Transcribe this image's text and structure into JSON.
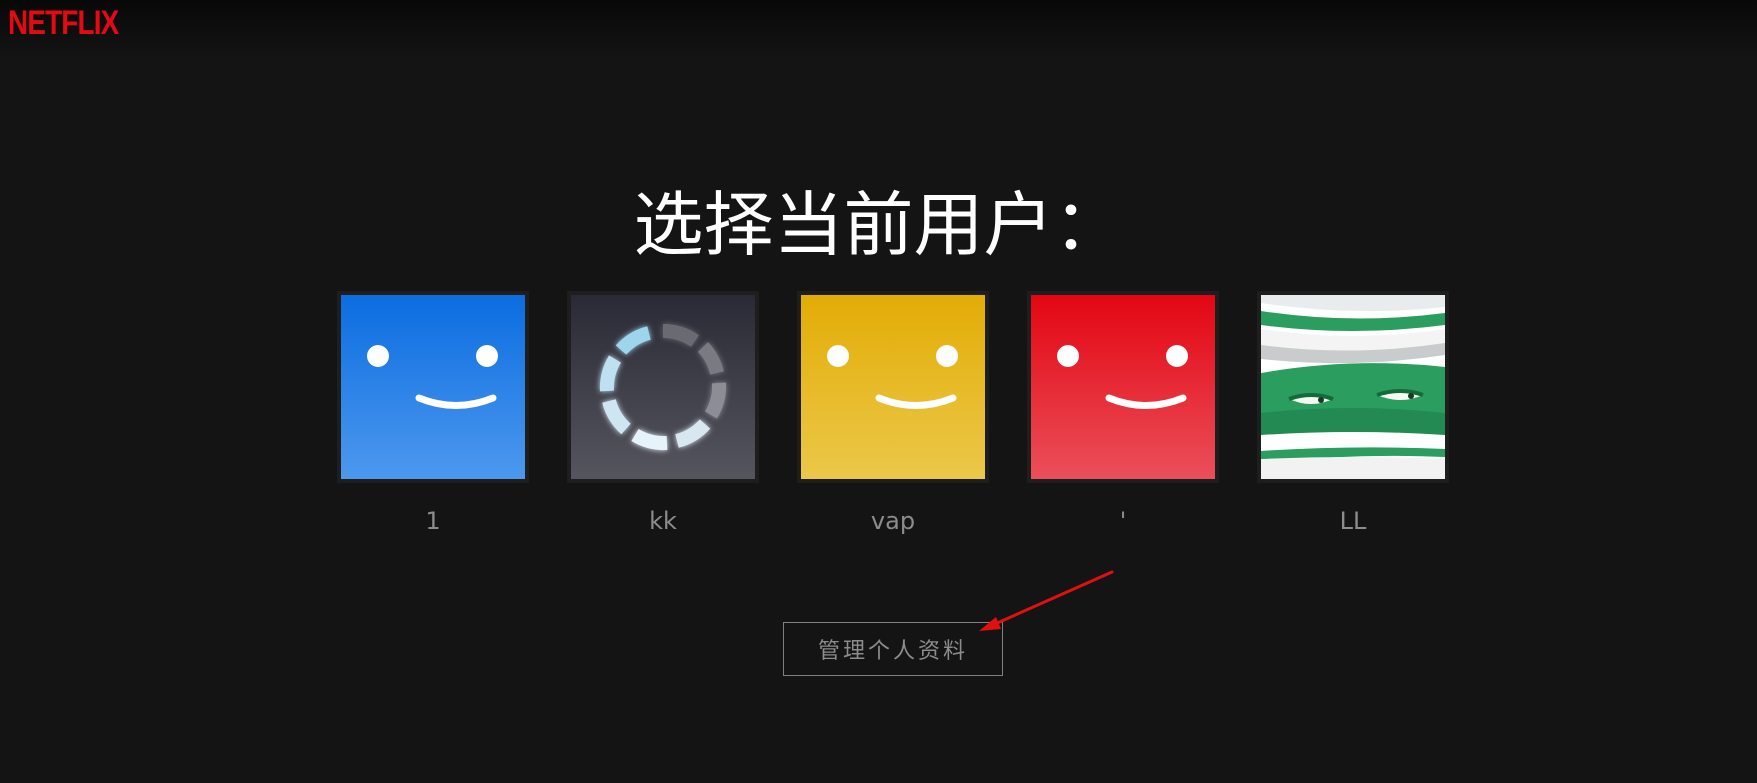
{
  "header": {
    "logo_text": "NETFLIX"
  },
  "main": {
    "title": "选择当前用户：",
    "profiles": [
      {
        "name": "1",
        "avatar": "blue-smiley",
        "color": "#1f7ee6"
      },
      {
        "name": "kk",
        "avatar": "loading-spinner",
        "color": "#3d3d48"
      },
      {
        "name": "vap",
        "avatar": "yellow-smiley",
        "color": "#e8b81e"
      },
      {
        "name": "'",
        "avatar": "red-smiley",
        "color": "#e50914"
      },
      {
        "name": "LL",
        "avatar": "green-mummy",
        "color": "#2aa566"
      }
    ],
    "manage_label": "管理个人资料"
  },
  "colors": {
    "background": "#141414",
    "brand": "#e50914",
    "annotation_arrow": "#e01010"
  }
}
